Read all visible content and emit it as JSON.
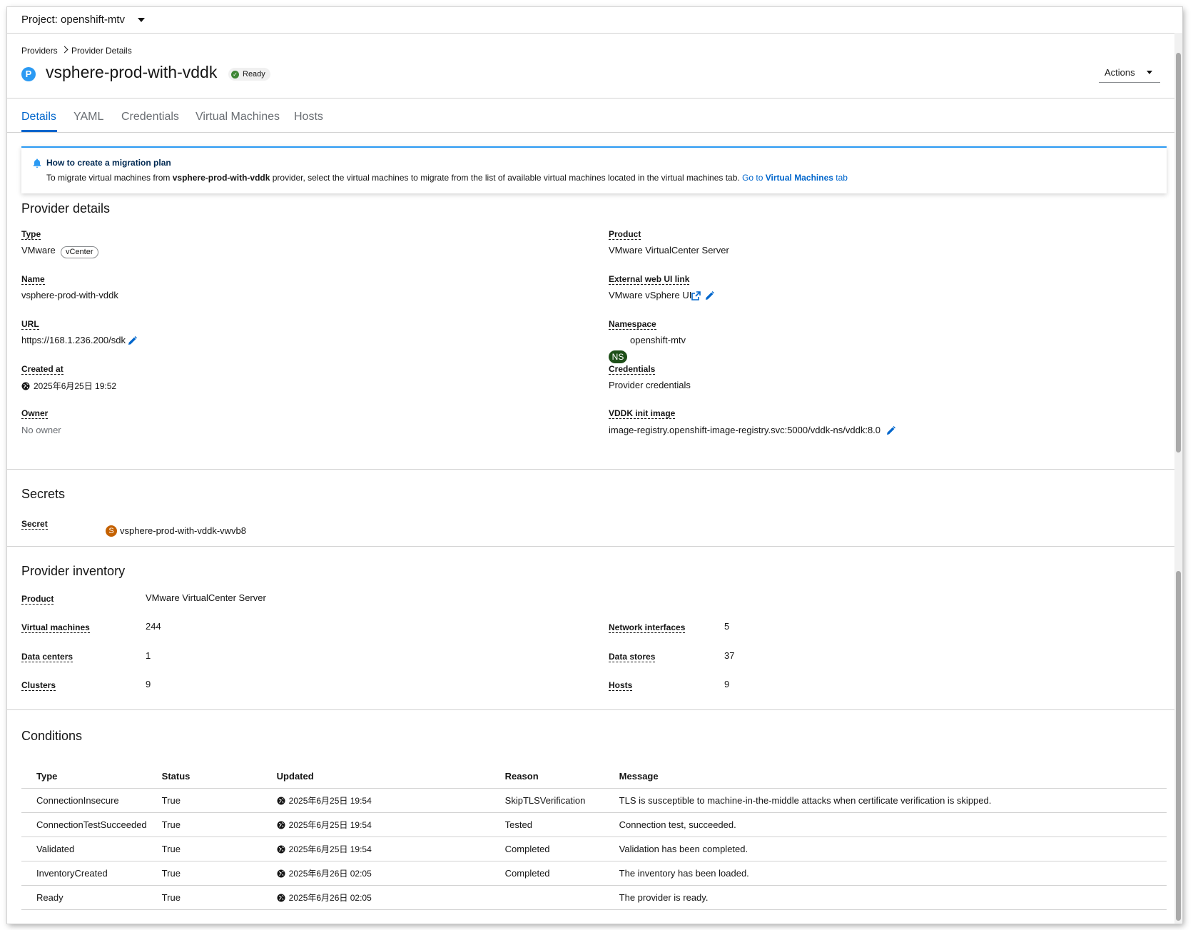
{
  "header": {
    "project_label": "Project: openshift-mtv"
  },
  "breadcrumb": {
    "items": [
      "Providers",
      "Provider Details"
    ]
  },
  "page": {
    "badge_letter": "P",
    "title": "vsphere-prod-with-vddk",
    "status": "Ready",
    "actions_label": "Actions"
  },
  "tabs": [
    {
      "label": "Details",
      "active": true
    },
    {
      "label": "YAML",
      "active": false
    },
    {
      "label": "Credentials",
      "active": false
    },
    {
      "label": "Virtual Machines",
      "active": false
    },
    {
      "label": "Hosts",
      "active": false
    }
  ],
  "alert": {
    "title": "How to create a migration plan",
    "body_prefix": "To migrate virtual machines from ",
    "body_provider": "vsphere-prod-with-vddk",
    "body_suffix": " provider, select the virtual machines to migrate from the list of available virtual machines located in the virtual machines tab. ",
    "link_prefix": "Go to ",
    "link_bold": "Virtual Machines",
    "link_suffix": " tab"
  },
  "provider_details": {
    "heading": "Provider details",
    "type_label": "Type",
    "type_value": "VMware",
    "type_chip": "vCenter",
    "name_label": "Name",
    "name_value": "vsphere-prod-with-vddk",
    "url_label": "URL",
    "url_value": "https://168.1.236.200/sdk",
    "created_label": "Created at",
    "created_value": "2025年6月25日 19:52",
    "owner_label": "Owner",
    "owner_value": "No owner",
    "product_label": "Product",
    "product_value": "VMware VirtualCenter Server",
    "ext_label": "External web UI link",
    "ext_value": "VMware vSphere UI",
    "namespace_label": "Namespace",
    "namespace_badge": "NS",
    "namespace_value": "openshift-mtv",
    "credentials_label": "Credentials",
    "credentials_value": "Provider credentials",
    "vddk_label": "VDDK init image",
    "vddk_value": "image-registry.openshift-image-registry.svc:5000/vddk-ns/vddk:8.0"
  },
  "secrets": {
    "heading": "Secrets",
    "secret_label": "Secret",
    "secret_badge": "S",
    "secret_value": "vsphere-prod-with-vddk-vwvb8"
  },
  "inventory": {
    "heading": "Provider inventory",
    "product_label": "Product",
    "product_value": "VMware VirtualCenter Server",
    "vms_label": "Virtual machines",
    "vms_value": "244",
    "datacenters_label": "Data centers",
    "datacenters_value": "1",
    "clusters_label": "Clusters",
    "clusters_value": "9",
    "nics_label": "Network interfaces",
    "nics_value": "5",
    "datastores_label": "Data stores",
    "datastores_value": "37",
    "hosts_label": "Hosts",
    "hosts_value": "9"
  },
  "conditions": {
    "heading": "Conditions",
    "columns": [
      "Type",
      "Status",
      "Updated",
      "Reason",
      "Message"
    ],
    "rows": [
      {
        "type": "ConnectionInsecure",
        "status": "True",
        "updated": "2025年6月25日 19:54",
        "reason": "SkipTLSVerification",
        "message": "TLS is susceptible to machine-in-the-middle attacks when certificate verification is skipped."
      },
      {
        "type": "ConnectionTestSucceeded",
        "status": "True",
        "updated": "2025年6月25日 19:54",
        "reason": "Tested",
        "message": "Connection test, succeeded."
      },
      {
        "type": "Validated",
        "status": "True",
        "updated": "2025年6月25日 19:54",
        "reason": "Completed",
        "message": "Validation has been completed."
      },
      {
        "type": "InventoryCreated",
        "status": "True",
        "updated": "2025年6月26日 02:05",
        "reason": "Completed",
        "message": "The inventory has been loaded."
      },
      {
        "type": "Ready",
        "status": "True",
        "updated": "2025年6月26日 02:05",
        "reason": "",
        "message": "The provider is ready."
      }
    ]
  },
  "colors": {
    "link": "#0066cc",
    "ready": "#3e8635",
    "ns_badge": "#1e4f18",
    "secret_badge": "#c46100",
    "provider_badge": "#2b9af3"
  }
}
